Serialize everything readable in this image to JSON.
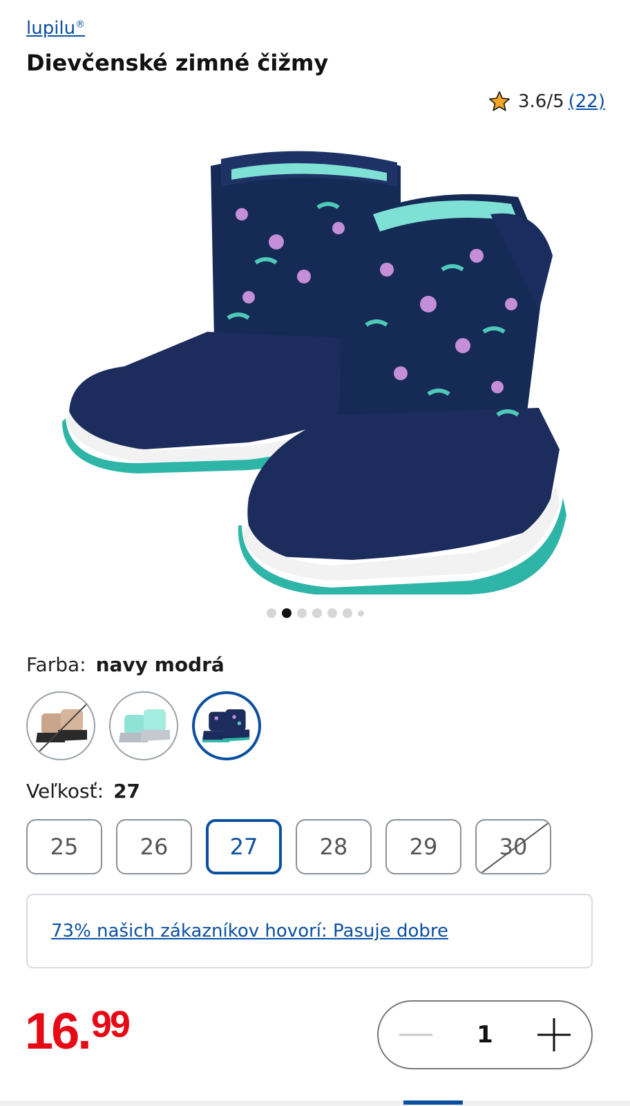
{
  "brand": {
    "name": "lupilu",
    "mark": "®"
  },
  "product": {
    "title": "Dievčenské zimné čižmy"
  },
  "rating": {
    "score": "3.6/5",
    "count": "(22)",
    "icon": "star-icon",
    "star_color": "#f5a623"
  },
  "gallery": {
    "image_icon": "snow-boots-image",
    "dots_total": 7,
    "dots_active_index": 1
  },
  "color": {
    "label": "Farba:",
    "selected": "navy modrá",
    "swatches": [
      {
        "name": "beige-black",
        "available": false,
        "selected": false
      },
      {
        "name": "mint-silver",
        "available": true,
        "selected": false
      },
      {
        "name": "navy-floral",
        "available": true,
        "selected": true
      }
    ]
  },
  "size": {
    "label": "Veľkosť:",
    "selected": "27",
    "options": [
      {
        "label": "25",
        "available": true,
        "selected": false
      },
      {
        "label": "26",
        "available": true,
        "selected": false
      },
      {
        "label": "27",
        "available": true,
        "selected": true
      },
      {
        "label": "28",
        "available": true,
        "selected": false
      },
      {
        "label": "29",
        "available": true,
        "selected": false
      },
      {
        "label": "30",
        "available": false,
        "selected": false
      }
    ]
  },
  "fit": {
    "text": "73% našich zákazníkov hovorí:  Pasuje dobre"
  },
  "price": {
    "main": "16.",
    "decimals": "99",
    "color": "#e60a14"
  },
  "quantity": {
    "value": "1",
    "minus_icon": "minus-icon",
    "plus_icon": "plus-icon"
  },
  "colors": {
    "accent": "#0b4fa0",
    "text": "#1a1a1a"
  }
}
